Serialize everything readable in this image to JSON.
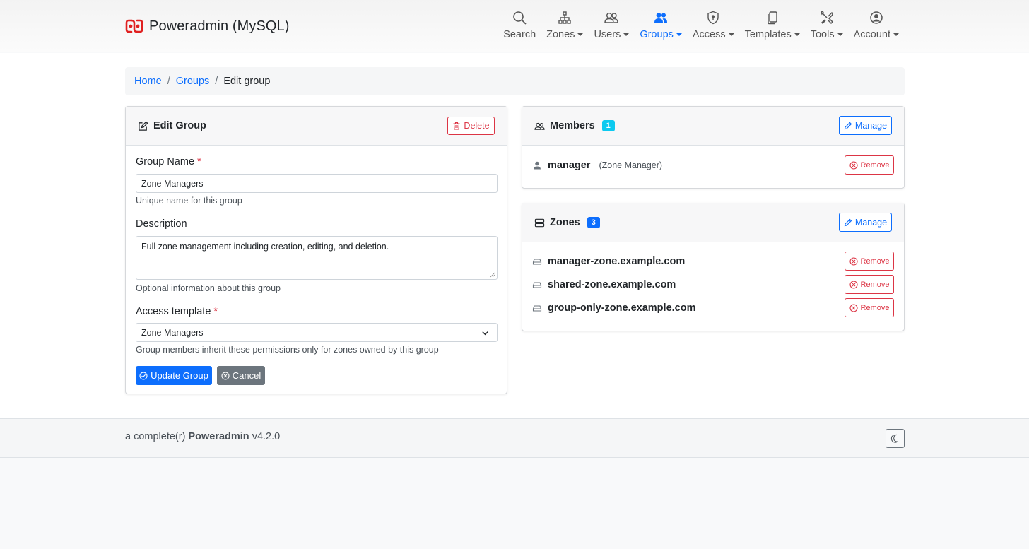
{
  "app": {
    "brand": "Poweradmin (MySQL)",
    "brand_color": "#e02020"
  },
  "nav": [
    {
      "label": "Search",
      "icon": "search-icon",
      "dropdown": false,
      "active": false
    },
    {
      "label": "Zones",
      "icon": "zones-icon",
      "dropdown": true,
      "active": false
    },
    {
      "label": "Users",
      "icon": "users-icon",
      "dropdown": true,
      "active": false
    },
    {
      "label": "Groups",
      "icon": "groups-icon",
      "dropdown": true,
      "active": true
    },
    {
      "label": "Access",
      "icon": "shield-icon",
      "dropdown": true,
      "active": false
    },
    {
      "label": "Templates",
      "icon": "templates-icon",
      "dropdown": true,
      "active": false
    },
    {
      "label": "Tools",
      "icon": "tools-icon",
      "dropdown": true,
      "active": false
    },
    {
      "label": "Account",
      "icon": "account-icon",
      "dropdown": true,
      "active": false
    }
  ],
  "breadcrumb": {
    "home": "Home",
    "groups": "Groups",
    "current": "Edit group"
  },
  "edit_group": {
    "title": "Edit Group",
    "delete_label": "Delete",
    "group_name_label": "Group Name",
    "required_mark": "*",
    "group_name_value": "Zone Managers",
    "group_name_help": "Unique name for this group",
    "description_label": "Description",
    "description_value": "Full zone management including creation, editing, and deletion.",
    "description_help": "Optional information about this group",
    "access_template_label": "Access template",
    "access_template_value": "Zone Managers",
    "access_template_help": "Group members inherit these permissions only for zones owned by this group",
    "update_label": "Update Group",
    "cancel_label": "Cancel"
  },
  "members": {
    "title": "Members",
    "count": "1",
    "manage_label": "Manage",
    "items": [
      {
        "name": "manager",
        "meta": "(Zone Manager)",
        "remove_label": "Remove"
      }
    ]
  },
  "zones": {
    "title": "Zones",
    "count": "3",
    "manage_label": "Manage",
    "items": [
      {
        "name": "manager-zone.example.com",
        "remove_label": "Remove"
      },
      {
        "name": "shared-zone.example.com",
        "remove_label": "Remove"
      },
      {
        "name": "group-only-zone.example.com",
        "remove_label": "Remove"
      }
    ]
  },
  "footer": {
    "prefix": "a complete(r)",
    "product": "Poweradmin",
    "version": "v4.2.0"
  },
  "colors": {
    "primary": "#0d6efd",
    "danger": "#dc3545",
    "info_badge": "#0dcaf0",
    "secondary": "#6c757d"
  }
}
